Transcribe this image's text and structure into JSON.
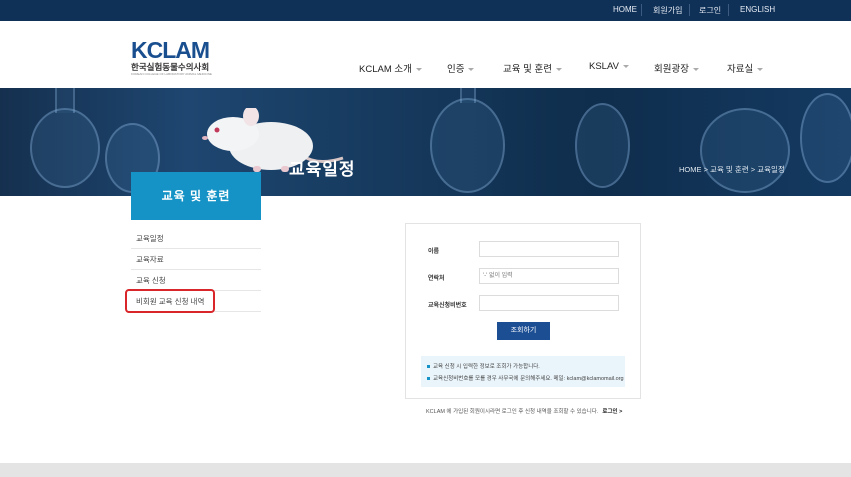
{
  "top_links": [
    "HOME",
    "회원가입",
    "로그인",
    "ENGLISH"
  ],
  "logo": {
    "mark": "KCLAM",
    "korean": "한국실험동물수의사회",
    "english": "KOREAN COLLEGE OF LABORATORY ANIMAL MEDICINE"
  },
  "nav": [
    "KCLAM 소개",
    "인증",
    "교육 및 훈련",
    "KSLAV",
    "회원광장",
    "자료실"
  ],
  "banner": {
    "title": "교육일정",
    "breadcrumb": "HOME > 교육 및 훈련 > 교육일정"
  },
  "sidebar": {
    "title": "교육 및 훈련",
    "items": [
      "교육일정",
      "교육자료",
      "교육 신청",
      "비회원 교육 신청 내역"
    ]
  },
  "form": {
    "name_label": "이름",
    "phone_label": "연락처",
    "phone_placeholder": "'-' 없이 입력",
    "pw_label": "교육신청비번호",
    "submit_label": "조회하기",
    "notices": [
      "교육 신청 시 입력한 정보로 조회가 가능합니다.",
      "교육신청비번호를 모를 경우 사무국에 문의해주세요. 메일: kclam@kclamomail.org"
    ]
  },
  "footer_note": {
    "text": "KCLAM 에 가입된 회원이시라면 로그인 후 신청 내역을 조회할 수 있습니다.",
    "link": "로그인 >"
  },
  "colors": {
    "topbar": "#0f3057",
    "sidebar_title": "#1593c6",
    "button": "#1c4e94",
    "highlight": "#d9262a"
  }
}
